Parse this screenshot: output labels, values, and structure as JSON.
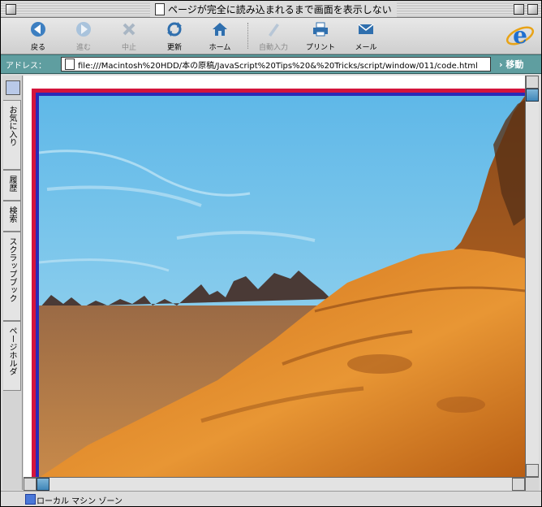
{
  "window": {
    "title": "ページが完全に読み込まれるまで画面を表示しない"
  },
  "toolbar": {
    "buttons": [
      {
        "label": "戻る",
        "icon": "back-arrow-icon"
      },
      {
        "label": "進む",
        "icon": "forward-arrow-icon"
      },
      {
        "label": "中止",
        "icon": "stop-icon"
      },
      {
        "label": "更新",
        "icon": "refresh-icon"
      },
      {
        "label": "ホーム",
        "icon": "home-icon"
      },
      {
        "label": "自動入力",
        "icon": "autofill-icon"
      },
      {
        "label": "プリント",
        "icon": "printer-icon"
      },
      {
        "label": "メール",
        "icon": "mail-icon"
      }
    ]
  },
  "address": {
    "label": "アドレス：",
    "url": "file:///Macintosh%20HDD/本の原稿/JavaScript%20Tips%20&%20Tricks/script/window/011/code.html",
    "go_label": "移動"
  },
  "sidebar": {
    "tabs": [
      "お気に入り",
      "履歴",
      "検索",
      "スクラップブック",
      "ページホルダ"
    ]
  },
  "status": {
    "text": "ローカル マシン ゾーン"
  },
  "colors": {
    "address_bar": "#5f9ea0",
    "frame_red": "#d4143c",
    "frame_blue": "#2a2ab8",
    "sky": "#7fc7e6",
    "terrain": "#d9801f"
  }
}
